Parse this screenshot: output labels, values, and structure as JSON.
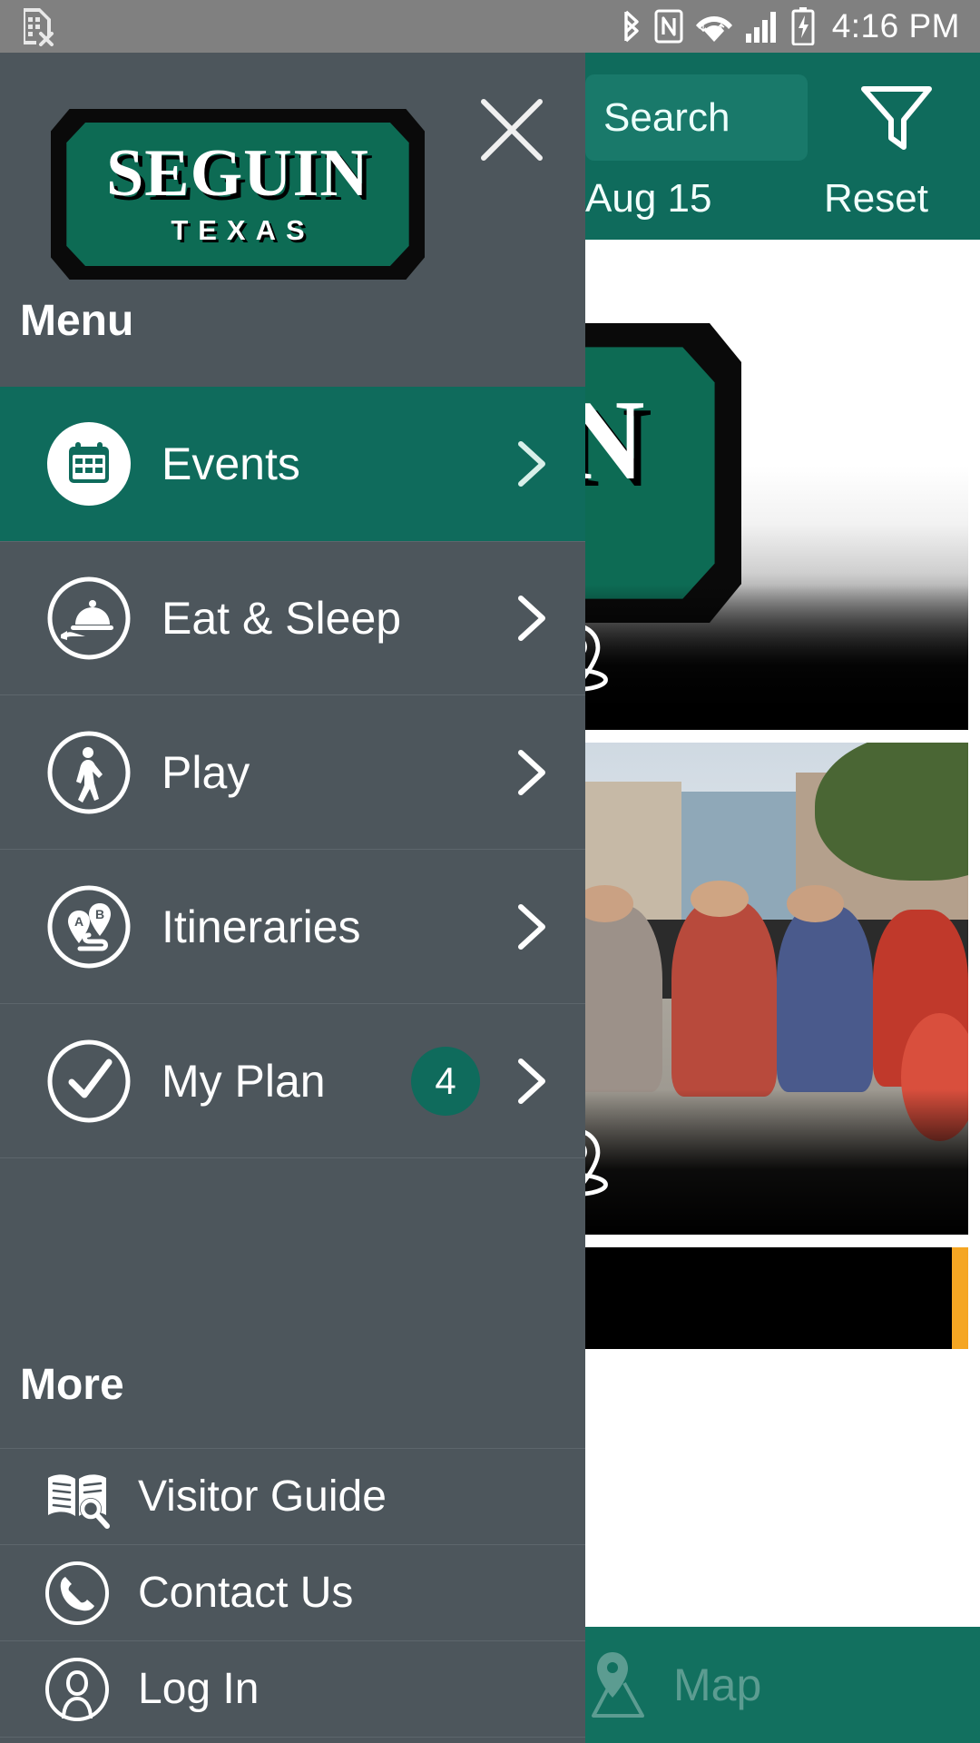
{
  "status_bar": {
    "time": "4:16 PM",
    "icons": {
      "sim_error": "sim-card-error-icon",
      "bluetooth": "bluetooth-icon",
      "nfc": "nfc-icon",
      "wifi": "wifi-icon",
      "signal": "cellular-signal-icon",
      "battery": "battery-charging-icon"
    }
  },
  "toolbar": {
    "search_placeholder": "Search",
    "filter_icon": "filter-funnel-icon",
    "date_filter": "Aug 15",
    "reset_label": "Reset"
  },
  "drawer": {
    "close_icon": "close-icon",
    "logo": {
      "line1": "SEGUIN",
      "line2": "TEXAS"
    },
    "menu_heading": "Menu",
    "menu_items": [
      {
        "label": "Events",
        "icon": "calendar-icon",
        "active": true,
        "badge": null,
        "chevron": true
      },
      {
        "label": "Eat & Sleep",
        "icon": "room-service-icon",
        "active": false,
        "badge": null,
        "chevron": true
      },
      {
        "label": "Play",
        "icon": "walking-person-icon",
        "active": false,
        "badge": null,
        "chevron": true
      },
      {
        "label": "Itineraries",
        "icon": "route-pins-icon",
        "active": false,
        "badge": null,
        "chevron": true
      },
      {
        "label": "My Plan",
        "icon": "check-circle-icon",
        "active": false,
        "badge": "4",
        "chevron": true
      }
    ],
    "more_heading": "More",
    "more_items": [
      {
        "label": "Visitor Guide",
        "icon": "book-search-icon"
      },
      {
        "label": "Contact Us",
        "icon": "phone-circle-icon"
      },
      {
        "label": "Log In",
        "icon": "person-circle-icon"
      }
    ]
  },
  "cards": [
    {
      "name": "seguin-logo-card",
      "media": "seguin-logo-image",
      "actions": [
        {
          "icon": "plus-circle-icon",
          "name": "add-to-plan-button"
        },
        {
          "icon": "map-pin-icon",
          "name": "show-on-map-button"
        }
      ]
    },
    {
      "name": "street-festival-card",
      "media": "crowd-photo-image",
      "actions": [
        {
          "icon": "plus-circle-icon",
          "name": "add-to-plan-button"
        },
        {
          "icon": "map-pin-icon",
          "name": "show-on-map-button"
        }
      ]
    },
    {
      "name": "partial-card",
      "media": "black-placeholder",
      "accent_color": "#f5a623"
    }
  ],
  "bottom_bar": {
    "map_label": "Map",
    "map_icon": "map-pin-terrain-icon"
  },
  "colors": {
    "brand_green": "#0f6b5c",
    "drawer_gray": "#4d565c",
    "status_gray": "#808080",
    "accent_orange": "#f5a623",
    "badge_green": "#0f6b5c"
  }
}
